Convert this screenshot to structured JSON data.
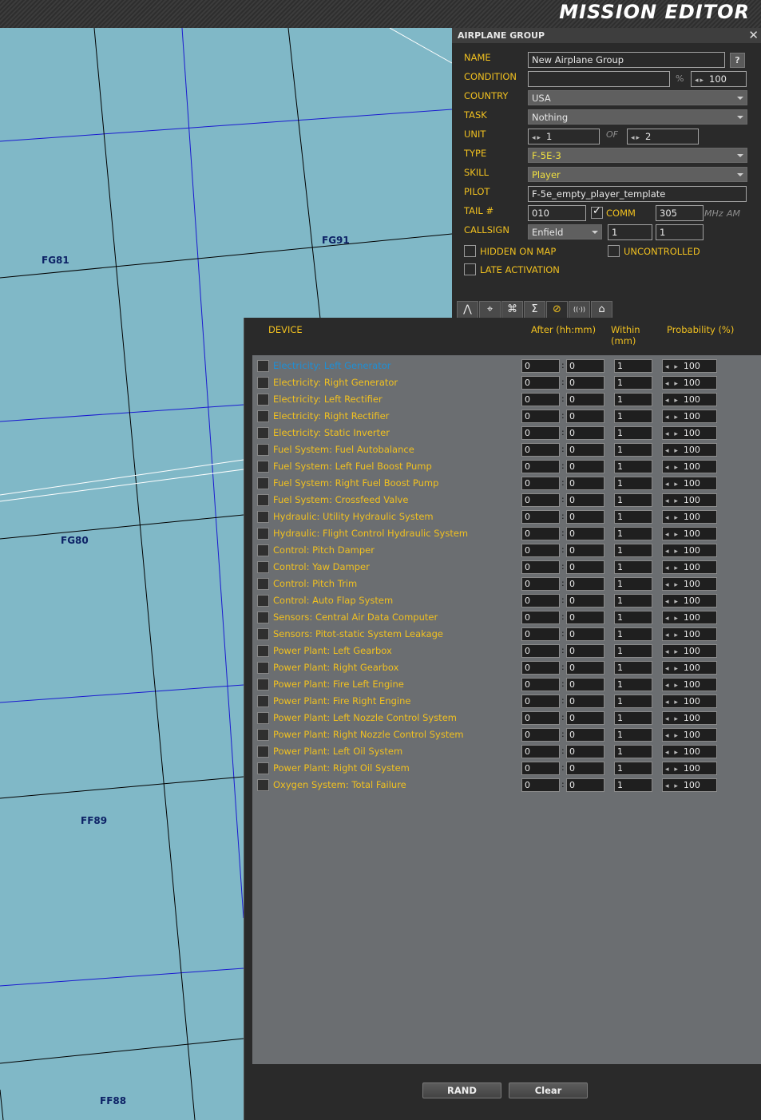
{
  "app": {
    "title": "MISSION EDITOR"
  },
  "map": {
    "grid_labels": [
      "FG81",
      "FG91",
      "FG80",
      "FF89",
      "FF88"
    ]
  },
  "panel": {
    "title": "AIRPLANE GROUP",
    "close_icon": "close-icon",
    "labels": {
      "name": "NAME",
      "condition": "CONDITION",
      "country": "COUNTRY",
      "task": "TASK",
      "unit": "UNIT",
      "type": "TYPE",
      "skill": "SKILL",
      "pilot": "PILOT",
      "tail": "TAIL #",
      "callsign": "CALLSIGN"
    },
    "name_value": "New Airplane Group",
    "help_label": "?",
    "condition_value": "",
    "condition_percent_label": "%",
    "condition_percent": "100",
    "country": "USA",
    "task": "Nothing",
    "unit_index": "1",
    "unit_of_label": "OF",
    "unit_total": "2",
    "type": "F-5E-3",
    "skill": "Player",
    "pilot": "F-5e_empty_player_template",
    "tail": "010",
    "comm_label": "COMM",
    "comm_checked": true,
    "frequency": "305",
    "frequency_unit": "MHz",
    "modulation": "AM",
    "callsign_name": "Enfield",
    "callsign_num1": "1",
    "callsign_num2": "1",
    "hidden_on_map": "HIDDEN ON MAP",
    "uncontrolled": "UNCONTROLLED",
    "late_activation": "LATE ACTIVATION"
  },
  "tabs": [
    {
      "icon": "route-icon",
      "glyph": "⋀"
    },
    {
      "icon": "targeting-icon",
      "glyph": "⌖"
    },
    {
      "icon": "command-icon",
      "glyph": "⌘"
    },
    {
      "icon": "sum-icon",
      "glyph": "Σ"
    },
    {
      "icon": "failures-icon",
      "glyph": "⊘",
      "active": true
    },
    {
      "icon": "radio-icon",
      "glyph": "((·))"
    },
    {
      "icon": "payload-icon",
      "glyph": "⌂"
    }
  ],
  "failures": {
    "headers": {
      "device": "DEVICE",
      "after": "After (hh:mm)",
      "within": "Within\n(mm)",
      "probability": "Probability (%)"
    },
    "rows": [
      {
        "device": "Electricity: Left Generator",
        "h": "0",
        "m": "0",
        "within": "1",
        "prob": "100",
        "selected": true
      },
      {
        "device": "Electricity: Right Generator",
        "h": "0",
        "m": "0",
        "within": "1",
        "prob": "100"
      },
      {
        "device": "Electricity: Left Rectifier",
        "h": "0",
        "m": "0",
        "within": "1",
        "prob": "100"
      },
      {
        "device": "Electricity: Right Rectifier",
        "h": "0",
        "m": "0",
        "within": "1",
        "prob": "100"
      },
      {
        "device": "Electricity: Static Inverter",
        "h": "0",
        "m": "0",
        "within": "1",
        "prob": "100"
      },
      {
        "device": "Fuel System: Fuel Autobalance",
        "h": "0",
        "m": "0",
        "within": "1",
        "prob": "100"
      },
      {
        "device": "Fuel System: Left Fuel Boost Pump",
        "h": "0",
        "m": "0",
        "within": "1",
        "prob": "100"
      },
      {
        "device": "Fuel System: Right Fuel Boost Pump",
        "h": "0",
        "m": "0",
        "within": "1",
        "prob": "100"
      },
      {
        "device": "Fuel System: Crossfeed Valve",
        "h": "0",
        "m": "0",
        "within": "1",
        "prob": "100"
      },
      {
        "device": "Hydraulic: Utility Hydraulic System",
        "h": "0",
        "m": "0",
        "within": "1",
        "prob": "100"
      },
      {
        "device": "Hydraulic: Flight Control Hydraulic System",
        "h": "0",
        "m": "0",
        "within": "1",
        "prob": "100"
      },
      {
        "device": "Control: Pitch Damper",
        "h": "0",
        "m": "0",
        "within": "1",
        "prob": "100"
      },
      {
        "device": "Control: Yaw Damper",
        "h": "0",
        "m": "0",
        "within": "1",
        "prob": "100"
      },
      {
        "device": "Control: Pitch Trim",
        "h": "0",
        "m": "0",
        "within": "1",
        "prob": "100"
      },
      {
        "device": "Control: Auto Flap System",
        "h": "0",
        "m": "0",
        "within": "1",
        "prob": "100"
      },
      {
        "device": "Sensors: Central Air Data Computer",
        "h": "0",
        "m": "0",
        "within": "1",
        "prob": "100"
      },
      {
        "device": "Sensors: Pitot-static System Leakage",
        "h": "0",
        "m": "0",
        "within": "1",
        "prob": "100"
      },
      {
        "device": "Power Plant: Left Gearbox",
        "h": "0",
        "m": "0",
        "within": "1",
        "prob": "100"
      },
      {
        "device": "Power Plant: Right Gearbox",
        "h": "0",
        "m": "0",
        "within": "1",
        "prob": "100"
      },
      {
        "device": "Power Plant: Fire Left Engine",
        "h": "0",
        "m": "0",
        "within": "1",
        "prob": "100"
      },
      {
        "device": "Power Plant: Fire Right Engine",
        "h": "0",
        "m": "0",
        "within": "1",
        "prob": "100"
      },
      {
        "device": "Power Plant: Left Nozzle Control System",
        "h": "0",
        "m": "0",
        "within": "1",
        "prob": "100"
      },
      {
        "device": "Power Plant: Right Nozzle Control System",
        "h": "0",
        "m": "0",
        "within": "1",
        "prob": "100"
      },
      {
        "device": "Power Plant: Left Oil System",
        "h": "0",
        "m": "0",
        "within": "1",
        "prob": "100"
      },
      {
        "device": "Power Plant: Right Oil System",
        "h": "0",
        "m": "0",
        "within": "1",
        "prob": "100"
      },
      {
        "device": "Oxygen System: Total Failure",
        "h": "0",
        "m": "0",
        "within": "1",
        "prob": "100"
      }
    ],
    "rand_label": "RAND",
    "clear_label": "Clear"
  },
  "colors": {
    "accent": "#f0c020",
    "selected": "#1e8fd6",
    "map": "#80b8c7",
    "grid_line": "#1a1ad0"
  }
}
